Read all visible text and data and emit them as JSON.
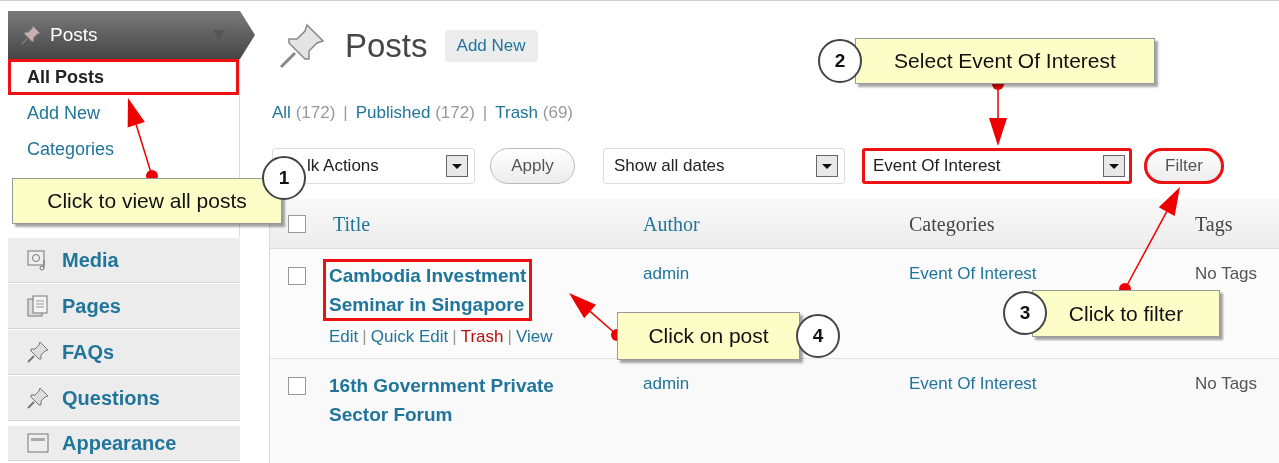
{
  "sidebar": {
    "header": {
      "label": "Posts"
    },
    "submenu": [
      {
        "label": "All Posts",
        "selected": true,
        "highlighted": true
      },
      {
        "label": "Add New",
        "selected": false,
        "highlighted": false
      },
      {
        "label": "Categories",
        "selected": false,
        "highlighted": false
      }
    ],
    "menu": [
      {
        "label": "Media",
        "kind": "media"
      },
      {
        "label": "Pages",
        "kind": "pages"
      },
      {
        "label": "FAQs",
        "kind": "pin"
      },
      {
        "label": "Questions",
        "kind": "pin"
      },
      {
        "label": "Appearance",
        "kind": "appearance"
      }
    ]
  },
  "page": {
    "title": "Posts",
    "add_new": "Add New"
  },
  "views": [
    {
      "label": "All",
      "count": "(172)"
    },
    {
      "separator": "|",
      "label": "Published",
      "count": "(172)"
    },
    {
      "separator": "|",
      "label": "Trash",
      "count": "(69)"
    }
  ],
  "controls": [
    {
      "kind": "select",
      "value": "lk Actions",
      "highlighted": false
    },
    {
      "kind": "button",
      "value": "Apply",
      "highlighted": false
    },
    {
      "kind": "select",
      "value": "Show all dates",
      "highlighted": false
    },
    {
      "kind": "select",
      "value": "Event Of Interest",
      "highlighted": true
    },
    {
      "kind": "button",
      "value": "Filter",
      "highlighted": true
    }
  ],
  "table": {
    "select_all_checked": false,
    "columns": [
      "Title",
      "Author",
      "Categories",
      "Tags"
    ],
    "rows": [
      {
        "checked": false,
        "title": [
          "Cambodia Investment",
          "Seminar in Singapore"
        ],
        "highlighted": true,
        "author": "admin",
        "category": "Event Of Interest",
        "tags": "No Tags",
        "actions": [
          {
            "label": "Edit",
            "kind": "link"
          },
          {
            "separator": "|",
            "label": "Quick Edit",
            "kind": "link"
          },
          {
            "separator": "|",
            "label": "Trash",
            "kind": "danger"
          },
          {
            "separator": "|",
            "label": "View",
            "kind": "link"
          }
        ]
      },
      {
        "checked": false,
        "title": [
          "16th Government Private",
          "Sector Forum"
        ],
        "highlighted": false,
        "author": "admin",
        "category": "Event Of Interest",
        "tags": "No Tags",
        "actions": []
      }
    ]
  },
  "callouts": [
    {
      "number": "1",
      "text": "Click to view all posts"
    },
    {
      "number": "2",
      "text": "Select Event Of Interest"
    },
    {
      "number": "3",
      "text": "Click to filter"
    },
    {
      "number": "4",
      "text": "Click on post"
    }
  ]
}
